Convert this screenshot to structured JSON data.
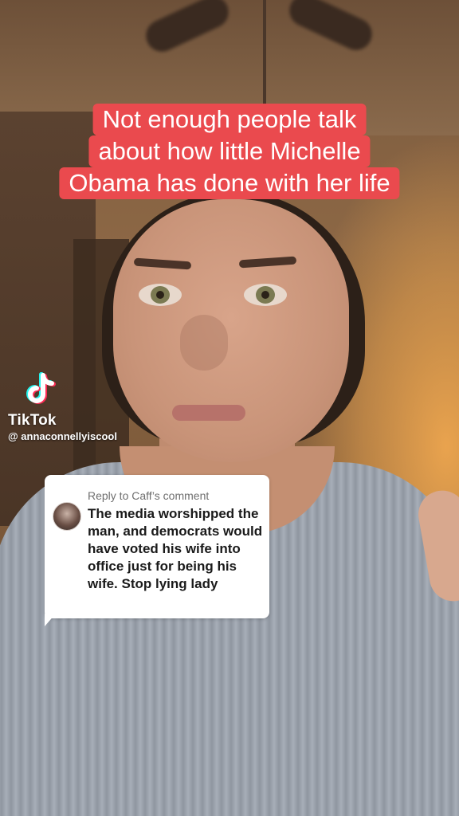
{
  "caption": {
    "lines": [
      "Not enough people talk",
      "about how little Michelle",
      "Obama has done with her life"
    ]
  },
  "watermark": {
    "brand": "TikTok",
    "handle": "@ annaconnellyiscool",
    "icon": "tiktok-logo-icon"
  },
  "reply_card": {
    "header": "Reply to Caff’s comment",
    "comment": "The media worshipped the man, and democrats would have voted his wife into office just for being his wife. Stop lying lady"
  },
  "colors": {
    "caption_background": "#ea4a4e",
    "caption_text": "#ffffff",
    "card_background": "#ffffff"
  }
}
